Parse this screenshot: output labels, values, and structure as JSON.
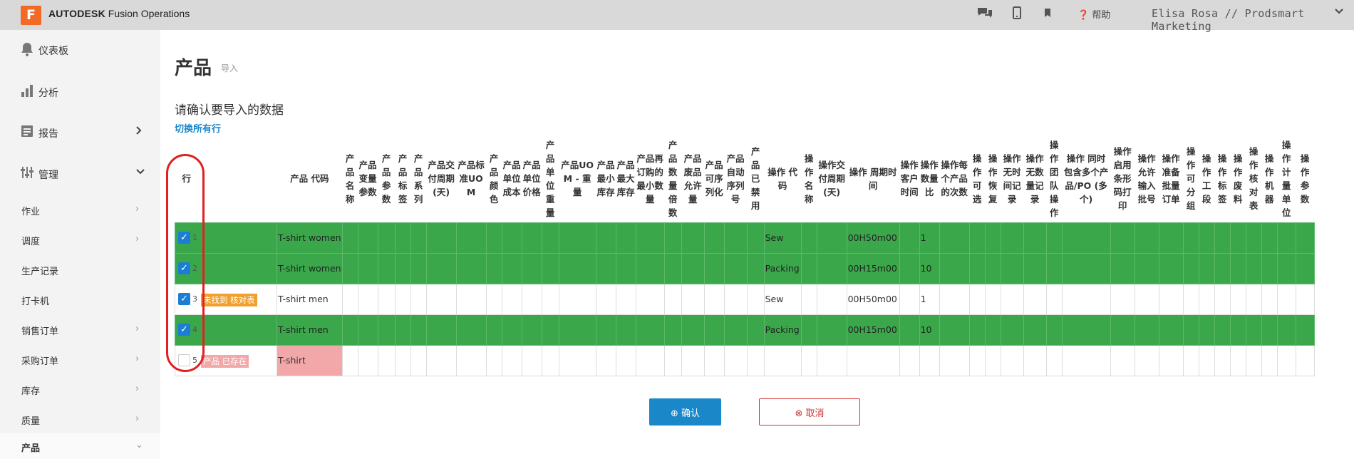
{
  "app": {
    "logo_letter": "F",
    "brand_bold": "AUTODESK",
    "brand_rest": " Fusion Operations",
    "help_label": "帮助",
    "user_label": "Elisa Rosa // Prodsmart Marketing"
  },
  "sidebar": {
    "main_items": [
      {
        "label": "仪表板"
      },
      {
        "label": "分析"
      },
      {
        "label": "报告"
      },
      {
        "label": "管理"
      }
    ],
    "sub_items": [
      {
        "label": "作业"
      },
      {
        "label": "调度"
      },
      {
        "label": "生产记录"
      },
      {
        "label": "打卡机"
      },
      {
        "label": "销售订单"
      },
      {
        "label": "采购订单"
      },
      {
        "label": "库存"
      },
      {
        "label": "质量"
      },
      {
        "label": "产品"
      }
    ]
  },
  "page": {
    "title": "产品",
    "subtitle": "导入",
    "confirm_heading": "请确认要导入的数据",
    "toggle_all_rows": "切换所有行"
  },
  "table": {
    "headers": [
      "行",
      "产品 代码",
      "产品名称",
      "产品变量参数",
      "产品参数",
      "产品标签",
      "产品系列",
      "产品交付周期(天)",
      "产品标准UOM",
      "产品颜色",
      "产品单位成本",
      "产品单位价格",
      "产品单位重量",
      "产品UOM - 重量",
      "产品最小库存",
      "产品最大库存",
      "产品再订购的最小数量",
      "产品数量倍数",
      "产品废品允许量",
      "产品可序列化",
      "产品自动序列号",
      "产品已禁用",
      "操作 代码",
      "操作名称",
      "操作交付周期(天)",
      "操作 周期时间",
      "操作客户时间",
      "操作数量比",
      "操作每个产品的次数",
      "操作可选",
      "操作恢复",
      "操作无时间记录",
      "操作无数量记录",
      "操作团队操作",
      "操作 同时包含多个产品/PO (多个)",
      "操作启用条形码打印",
      "操作允许输入批号",
      "操作准备批量订单",
      "操作可分组",
      "操作工段",
      "操作标签",
      "操作废料",
      "操作核对表",
      "操作机器",
      "操作计量单位",
      "操作参数"
    ],
    "rows": [
      {
        "num": "1",
        "checked": true,
        "status": "green",
        "badge": "",
        "product_code": "T-shirt women",
        "op_code": "Sew",
        "cycle_time": "00H50m00",
        "qty_ratio": "1"
      },
      {
        "num": "2",
        "checked": true,
        "status": "green",
        "badge": "",
        "product_code": "T-shirt women",
        "op_code": "Packing",
        "cycle_time": "00H15m00",
        "qty_ratio": "10"
      },
      {
        "num": "3",
        "checked": true,
        "status": "white",
        "badge": "未找到 核对表",
        "product_code": "T-shirt men",
        "op_code": "Sew",
        "cycle_time": "00H50m00",
        "qty_ratio": "1"
      },
      {
        "num": "4",
        "checked": true,
        "status": "green",
        "badge": "",
        "product_code": "T-shirt men",
        "op_code": "Packing",
        "cycle_time": "00H15m00",
        "qty_ratio": "10"
      },
      {
        "num": "5",
        "checked": false,
        "status": "white",
        "badge": "产品 已存在",
        "product_code": "T-shirt",
        "op_code": "",
        "cycle_time": "",
        "qty_ratio": ""
      }
    ]
  },
  "buttons": {
    "confirm": "⊕ 确认",
    "cancel": "⊗ 取消"
  },
  "colors": {
    "accent": "#1a87c9",
    "row_ok": "#3aa84a",
    "warn_badge": "#f0a030",
    "error": "#f2a8a8",
    "highlight_oval": "#e02020"
  }
}
